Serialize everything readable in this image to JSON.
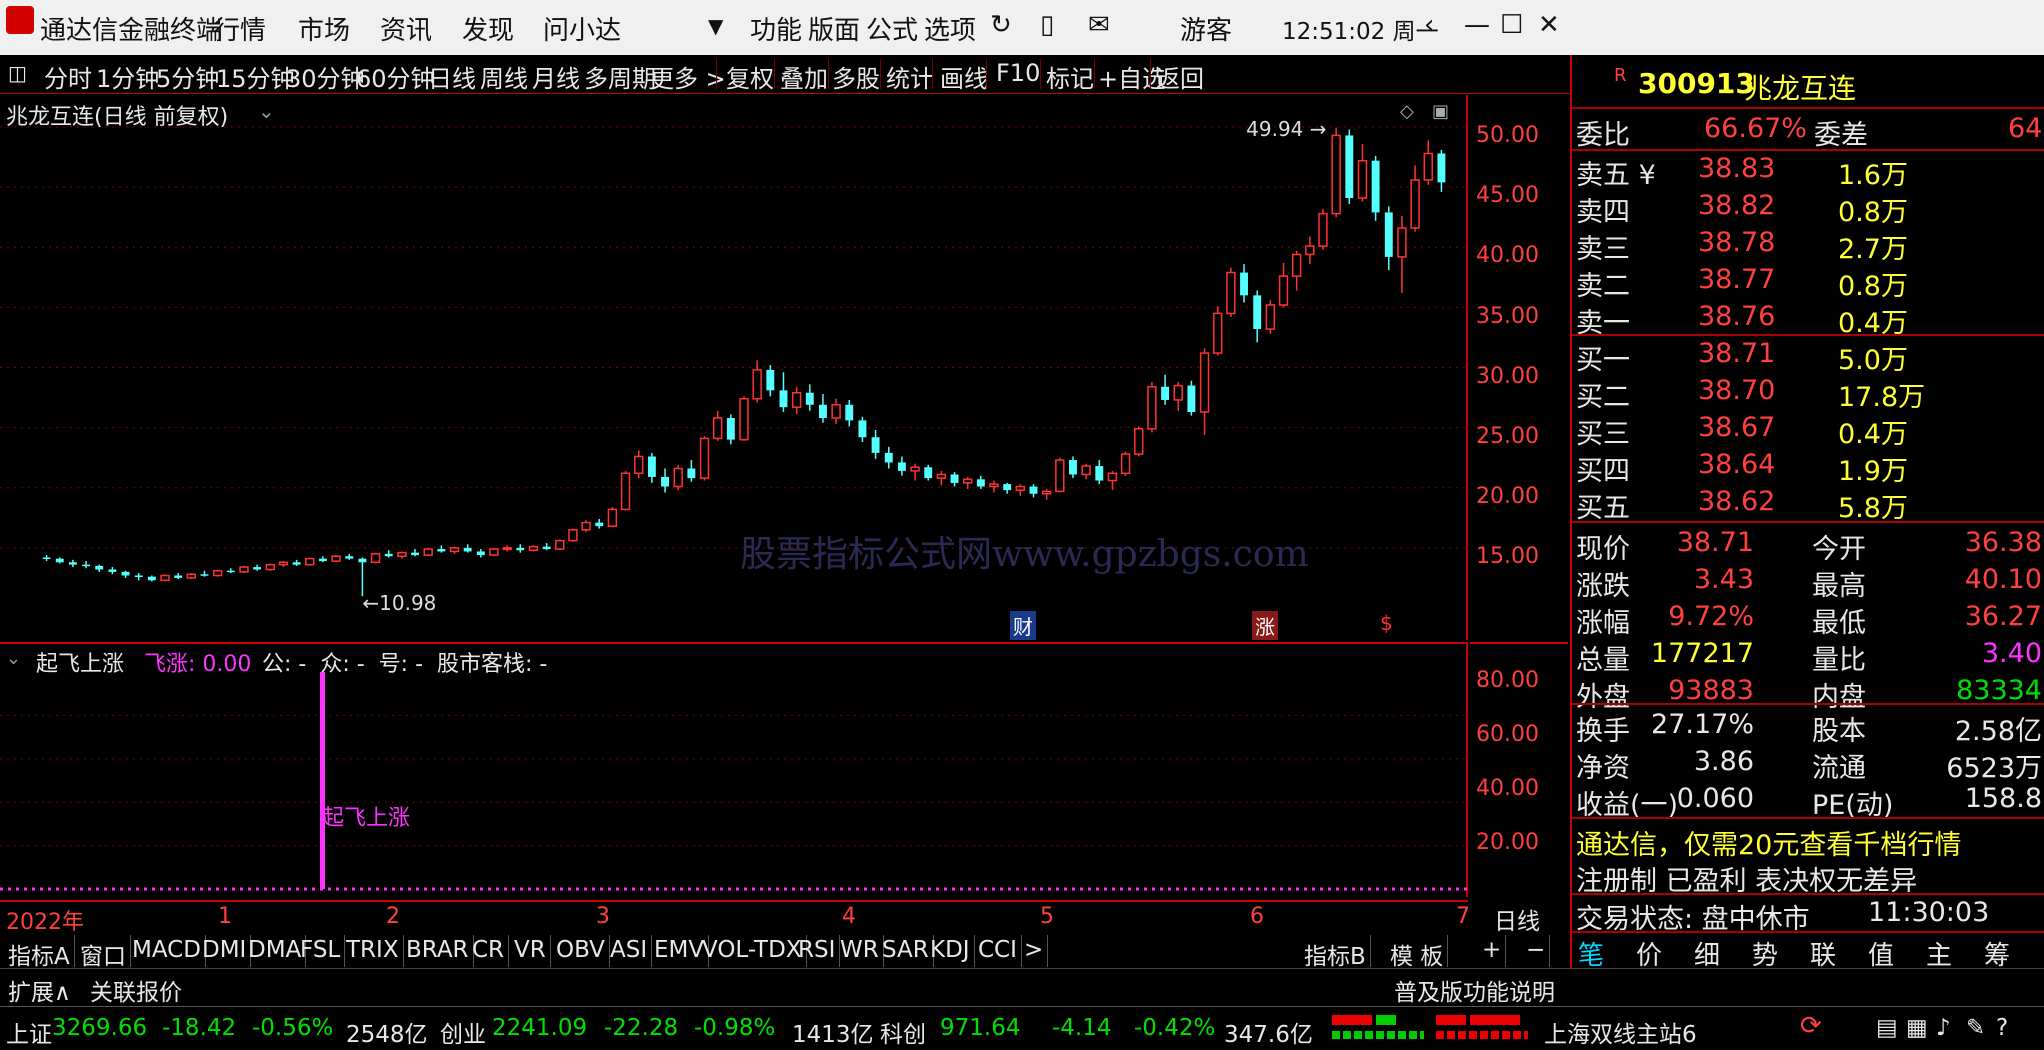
{
  "titlebar": {
    "app_title": "通达信金融终端",
    "menu": [
      "行情",
      "市场",
      "资讯",
      "发现",
      "问小达"
    ],
    "right_menu": [
      "功能",
      "版面",
      "公式",
      "选项"
    ],
    "user": "游客",
    "clock": "12:51:02 周一",
    "bg": "#f0f0f0"
  },
  "periods": [
    "分时",
    "1分钟",
    "5分钟",
    "15分钟",
    "30分钟",
    "60分钟",
    "日线",
    "周线",
    "月线",
    "多周期",
    "更多 >"
  ],
  "active_period": "日线",
  "toolbar_right": [
    "复权",
    "叠加",
    "多股",
    "统计",
    "画线",
    "F10",
    "标记",
    "+自选",
    "返回"
  ],
  "chart_title": "兆龙互连(日线 前复权)",
  "price_axis": [
    "50.00",
    "45.00",
    "40.00",
    "35.00",
    "30.00",
    "25.00",
    "20.00",
    "15.00"
  ],
  "annotations": {
    "high": "49.94",
    "low": "10.98"
  },
  "event_markers": [
    "财",
    "涨",
    "$"
  ],
  "watermark": "股票指标公式网www.gpzbgs.com",
  "indicator": {
    "title": "起飞上涨",
    "feizhang_label": "飞涨: 0.00",
    "extra": "公: -  众: -  号: -  股市客栈: -",
    "axis": [
      "80.00",
      "60.00",
      "40.00",
      "20.00"
    ],
    "signal_label": "起飞上涨"
  },
  "time_axis": [
    "2022年",
    "1",
    "2",
    "3",
    "4",
    "5",
    "6",
    "7"
  ],
  "period_label": "日线",
  "indicator_tabs": [
    "指标A",
    "窗口",
    "MACD",
    "DMI",
    "DMA",
    "FSL",
    "TRIX",
    "BRAR",
    "CR",
    "VR",
    "OBV",
    "ASI",
    "EMV",
    "VOL-TDX",
    "RSI",
    "WR",
    "SAR",
    "KDJ",
    "CCI",
    ">"
  ],
  "tabs_right": [
    "指标B",
    "模 板",
    "+",
    "−"
  ],
  "stock": {
    "code": "300913",
    "name": "兆龙互连",
    "flag": "R"
  },
  "weibi": {
    "label1": "委比",
    "value1": "66.67%",
    "label2": "委差",
    "value2": "64"
  },
  "asks": [
    {
      "label": "卖五 ¥",
      "price": "38.83",
      "vol": "1.6万"
    },
    {
      "label": "卖四",
      "price": "38.82",
      "vol": "0.8万"
    },
    {
      "label": "卖三",
      "price": "38.78",
      "vol": "2.7万"
    },
    {
      "label": "卖二",
      "price": "38.77",
      "vol": "0.8万"
    },
    {
      "label": "卖一",
      "price": "38.76",
      "vol": "0.4万"
    }
  ],
  "bids": [
    {
      "label": "买一",
      "price": "38.71",
      "vol": "5.0万"
    },
    {
      "label": "买二",
      "price": "38.70",
      "vol": "17.8万"
    },
    {
      "label": "买三",
      "price": "38.67",
      "vol": "0.4万"
    },
    {
      "label": "买四",
      "price": "38.64",
      "vol": "1.9万"
    },
    {
      "label": "买五",
      "price": "38.62",
      "vol": "5.8万"
    }
  ],
  "quote": [
    {
      "l1": "现价",
      "v1": "38.71",
      "c1": "red",
      "l2": "今开",
      "v2": "36.38",
      "c2": "red"
    },
    {
      "l1": "涨跌",
      "v1": "3.43",
      "c1": "red",
      "l2": "最高",
      "v2": "40.10",
      "c2": "red"
    },
    {
      "l1": "涨幅",
      "v1": "9.72%",
      "c1": "red",
      "l2": "最低",
      "v2": "36.27",
      "c2": "red"
    },
    {
      "l1": "总量",
      "v1": "177217",
      "c1": "yellow",
      "l2": "量比",
      "v2": "3.40",
      "c2": "magenta"
    },
    {
      "l1": "外盘",
      "v1": "93883",
      "c1": "red",
      "l2": "内盘",
      "v2": "83334",
      "c2": "green"
    }
  ],
  "quote2": [
    {
      "l1": "换手",
      "v1": "27.17%",
      "l2": "股本",
      "v2": "2.58亿"
    },
    {
      "l1": "净资",
      "v1": "3.86",
      "l2": "流通",
      "v2": "6523万"
    },
    {
      "l1": "收益(一)",
      "v1": "0.060",
      "l2": "PE(动)",
      "v2": "158.8"
    }
  ],
  "ad_lines": [
    "通达信，仅需20元查看千档行情",
    "注册制 已盈利 表决权无差异"
  ],
  "trade_status": {
    "label": "交易状态: 盘中休市",
    "time": "11:30:03"
  },
  "right_tabs": [
    "笔",
    "价",
    "细",
    "势",
    "联",
    "值",
    "主",
    "筹"
  ],
  "ext_bar": {
    "left": [
      "扩展∧",
      "关联报价"
    ],
    "right": "普及版功能说明"
  },
  "indices": [
    {
      "name": "上证",
      "value": "3269.66",
      "chg": "-18.42",
      "pct": "-0.56%",
      "amt": "2548亿"
    },
    {
      "name": "创业",
      "value": "2241.09",
      "chg": "-22.28",
      "pct": "-0.98%",
      "amt": "1413亿"
    },
    {
      "name": "科创",
      "value": "971.64",
      "chg": "-4.14",
      "pct": "-0.42%",
      "amt": "347.6亿"
    }
  ],
  "server": "上海双线主站6",
  "chart_data": {
    "type": "candlestick",
    "ylim": [
      8,
      52
    ],
    "ohlc": [
      [
        14.2,
        14.4,
        13.9,
        14.1
      ],
      [
        14.1,
        14.2,
        13.7,
        13.8
      ],
      [
        13.8,
        14.0,
        13.4,
        13.6
      ],
      [
        13.6,
        13.9,
        13.3,
        13.5
      ],
      [
        13.5,
        13.6,
        13.0,
        13.2
      ],
      [
        13.2,
        13.4,
        12.8,
        13.0
      ],
      [
        13.0,
        13.1,
        12.5,
        12.7
      ],
      [
        12.7,
        12.9,
        12.3,
        12.6
      ],
      [
        12.6,
        12.7,
        12.2,
        12.3
      ],
      [
        12.3,
        12.8,
        12.2,
        12.7
      ],
      [
        12.7,
        12.9,
        12.4,
        12.5
      ],
      [
        12.5,
        12.9,
        12.4,
        12.8
      ],
      [
        12.8,
        13.1,
        12.6,
        12.7
      ],
      [
        12.7,
        13.2,
        12.6,
        13.1
      ],
      [
        13.1,
        13.3,
        12.9,
        13.0
      ],
      [
        13.0,
        13.5,
        12.9,
        13.4
      ],
      [
        13.4,
        13.6,
        13.1,
        13.2
      ],
      [
        13.2,
        13.7,
        13.1,
        13.6
      ],
      [
        13.6,
        13.9,
        13.4,
        13.8
      ],
      [
        13.8,
        14.0,
        13.5,
        13.6
      ],
      [
        13.6,
        14.2,
        13.5,
        14.1
      ],
      [
        14.1,
        14.3,
        13.8,
        13.9
      ],
      [
        13.9,
        14.4,
        13.8,
        14.3
      ],
      [
        14.3,
        14.5,
        14.0,
        14.1
      ],
      [
        14.1,
        14.2,
        10.98,
        13.8
      ],
      [
        13.8,
        14.6,
        13.7,
        14.5
      ],
      [
        14.5,
        14.8,
        14.2,
        14.3
      ],
      [
        14.3,
        14.7,
        14.1,
        14.6
      ],
      [
        14.6,
        14.9,
        14.3,
        14.4
      ],
      [
        14.4,
        15.0,
        14.3,
        14.9
      ],
      [
        14.9,
        15.2,
        14.6,
        14.7
      ],
      [
        14.7,
        15.1,
        14.5,
        15.0
      ],
      [
        15.0,
        15.3,
        14.6,
        14.7
      ],
      [
        14.7,
        14.9,
        14.2,
        14.4
      ],
      [
        14.4,
        15.0,
        14.3,
        14.9
      ],
      [
        14.9,
        15.2,
        14.7,
        15.0
      ],
      [
        15.0,
        15.3,
        14.6,
        14.8
      ],
      [
        14.8,
        15.2,
        14.7,
        15.1
      ],
      [
        15.1,
        15.4,
        14.8,
        14.9
      ],
      [
        14.9,
        15.7,
        14.8,
        15.6
      ],
      [
        15.6,
        16.6,
        15.5,
        16.5
      ],
      [
        16.5,
        17.3,
        16.3,
        17.1
      ],
      [
        17.1,
        17.4,
        16.6,
        16.8
      ],
      [
        16.8,
        18.4,
        16.7,
        18.2
      ],
      [
        18.2,
        21.4,
        18.1,
        21.2
      ],
      [
        21.2,
        23.1,
        20.8,
        22.6
      ],
      [
        22.6,
        22.9,
        20.4,
        20.9
      ],
      [
        20.9,
        21.6,
        19.6,
        20.1
      ],
      [
        20.1,
        21.9,
        19.8,
        21.6
      ],
      [
        21.6,
        22.3,
        20.5,
        20.8
      ],
      [
        20.8,
        24.3,
        20.6,
        24.1
      ],
      [
        24.1,
        26.4,
        23.9,
        25.8
      ],
      [
        25.8,
        26.1,
        23.6,
        24.0
      ],
      [
        24.0,
        27.6,
        23.9,
        27.4
      ],
      [
        27.4,
        30.6,
        27.1,
        29.8
      ],
      [
        29.8,
        30.2,
        27.6,
        28.1
      ],
      [
        28.1,
        29.6,
        26.3,
        26.7
      ],
      [
        26.7,
        28.4,
        26.1,
        27.9
      ],
      [
        27.9,
        28.6,
        26.4,
        26.9
      ],
      [
        26.9,
        27.8,
        25.4,
        25.8
      ],
      [
        25.8,
        27.4,
        25.3,
        26.9
      ],
      [
        26.9,
        27.3,
        25.1,
        25.6
      ],
      [
        25.6,
        25.9,
        23.8,
        24.2
      ],
      [
        24.2,
        24.8,
        22.4,
        22.9
      ],
      [
        22.9,
        23.4,
        21.6,
        22.1
      ],
      [
        22.1,
        22.6,
        21.0,
        21.4
      ],
      [
        21.4,
        22.0,
        20.6,
        21.7
      ],
      [
        21.7,
        21.9,
        20.6,
        20.8
      ],
      [
        20.8,
        21.4,
        20.2,
        21.1
      ],
      [
        21.1,
        21.3,
        20.1,
        20.4
      ],
      [
        20.4,
        20.9,
        19.9,
        20.7
      ],
      [
        20.7,
        21.0,
        19.9,
        20.1
      ],
      [
        20.1,
        20.6,
        19.6,
        20.3
      ],
      [
        20.3,
        20.4,
        19.5,
        19.8
      ],
      [
        19.8,
        20.3,
        19.3,
        20.1
      ],
      [
        20.1,
        20.3,
        19.2,
        19.5
      ],
      [
        19.5,
        19.9,
        19.0,
        19.7
      ],
      [
        19.7,
        22.5,
        19.6,
        22.3
      ],
      [
        22.3,
        22.6,
        20.8,
        21.1
      ],
      [
        21.1,
        22.0,
        20.7,
        21.8
      ],
      [
        21.8,
        22.3,
        20.3,
        20.6
      ],
      [
        20.6,
        21.4,
        19.8,
        21.2
      ],
      [
        21.2,
        23.0,
        21.0,
        22.8
      ],
      [
        22.8,
        25.1,
        22.6,
        24.9
      ],
      [
        24.9,
        28.8,
        24.6,
        28.4
      ],
      [
        28.4,
        29.4,
        26.9,
        27.3
      ],
      [
        27.3,
        28.8,
        26.4,
        28.5
      ],
      [
        28.5,
        28.9,
        26.0,
        26.3
      ],
      [
        26.3,
        31.6,
        24.4,
        31.2
      ],
      [
        31.2,
        35.1,
        31.0,
        34.5
      ],
      [
        34.5,
        38.3,
        34.2,
        37.9
      ],
      [
        37.9,
        38.6,
        35.4,
        36.0
      ],
      [
        36.0,
        36.4,
        32.1,
        33.2
      ],
      [
        33.2,
        35.6,
        32.8,
        35.2
      ],
      [
        35.2,
        38.7,
        35.0,
        37.6
      ],
      [
        37.6,
        39.7,
        36.4,
        39.4
      ],
      [
        39.4,
        40.9,
        38.6,
        40.1
      ],
      [
        40.1,
        43.2,
        39.8,
        42.8
      ],
      [
        42.8,
        49.94,
        42.5,
        49.3
      ],
      [
        49.3,
        49.8,
        43.6,
        44.1
      ],
      [
        44.1,
        48.6,
        43.8,
        47.2
      ],
      [
        47.2,
        47.6,
        42.2,
        42.9
      ],
      [
        42.9,
        43.4,
        38.1,
        39.2
      ],
      [
        39.2,
        42.6,
        36.2,
        41.6
      ],
      [
        41.6,
        46.8,
        41.3,
        45.6
      ],
      [
        45.6,
        48.9,
        45.2,
        47.8
      ],
      [
        47.8,
        48.1,
        44.6,
        45.4
      ]
    ],
    "signal_index": 24,
    "signal_value": 100
  }
}
